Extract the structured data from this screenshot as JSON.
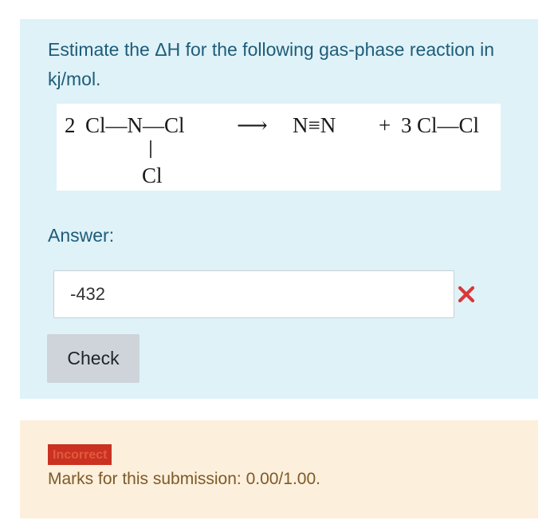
{
  "question": {
    "prompt": "Estimate the ΔH for the following gas-phase reaction in kj/mol.",
    "reaction": {
      "coef_left": "2",
      "reactant_main": "Cl—N—Cl",
      "reactant_branch": "Cl",
      "arrow": "⟶",
      "product1": "N≡N",
      "plus": "+",
      "coef_right": "3",
      "product2": "Cl—Cl"
    },
    "answer_label": "Answer:",
    "answer_value": "-432",
    "check_label": "Check"
  },
  "feedback": {
    "status": "Incorrect",
    "marks": "Marks for this submission: 0.00/1.00."
  },
  "colors": {
    "question_bg": "#def2f8",
    "feedback_bg": "#fcefdc",
    "prompt_text": "#1f5c78",
    "incorrect_badge": "#ca3120",
    "wrong_mark": "#d9383a"
  },
  "icons": {
    "wrong_mark": "cross-icon"
  }
}
